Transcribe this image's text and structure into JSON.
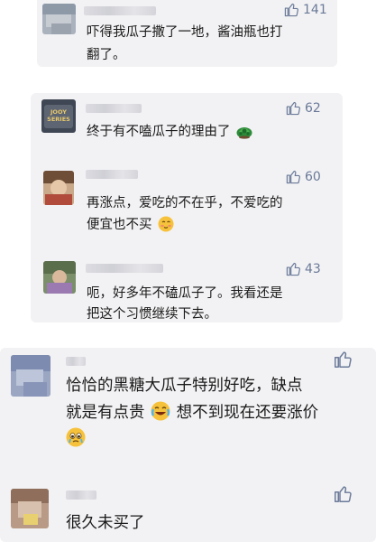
{
  "comments": [
    {
      "likes": "141",
      "lines": [
        "吓得我瓜子撒了一地，酱油瓶也打",
        "翻了。"
      ]
    },
    {
      "likes": "62",
      "lines": [
        "终于有不嗑瓜子的理由了"
      ],
      "avatar_text": [
        "JOOY",
        "SERIES"
      ]
    },
    {
      "likes": "60",
      "lines": [
        "再涨点，爱吃的不在乎，不爱吃的",
        "便宜也不买"
      ]
    },
    {
      "likes": "43",
      "lines": [
        "呃，好多年不磕瓜子了。我看还是",
        "把这个习惯继续下去。"
      ]
    },
    {
      "likes": "",
      "lines": [
        "恰恰的黑糖大瓜子特别好吃，缺点",
        "就是有点贵",
        "想不到现在还要涨价"
      ]
    },
    {
      "likes": "",
      "lines": [
        "很久未买了"
      ]
    }
  ],
  "colors": {
    "card_bg": "#f2f2f4",
    "like_icon": "#6b7a99",
    "text": "#1a1a1a"
  },
  "icons": [
    "thumbs-up-icon",
    "turtle-emoji-icon",
    "blushing-emoji-icon",
    "crying-laughing-emoji-icon",
    "teary-emoji-icon"
  ]
}
